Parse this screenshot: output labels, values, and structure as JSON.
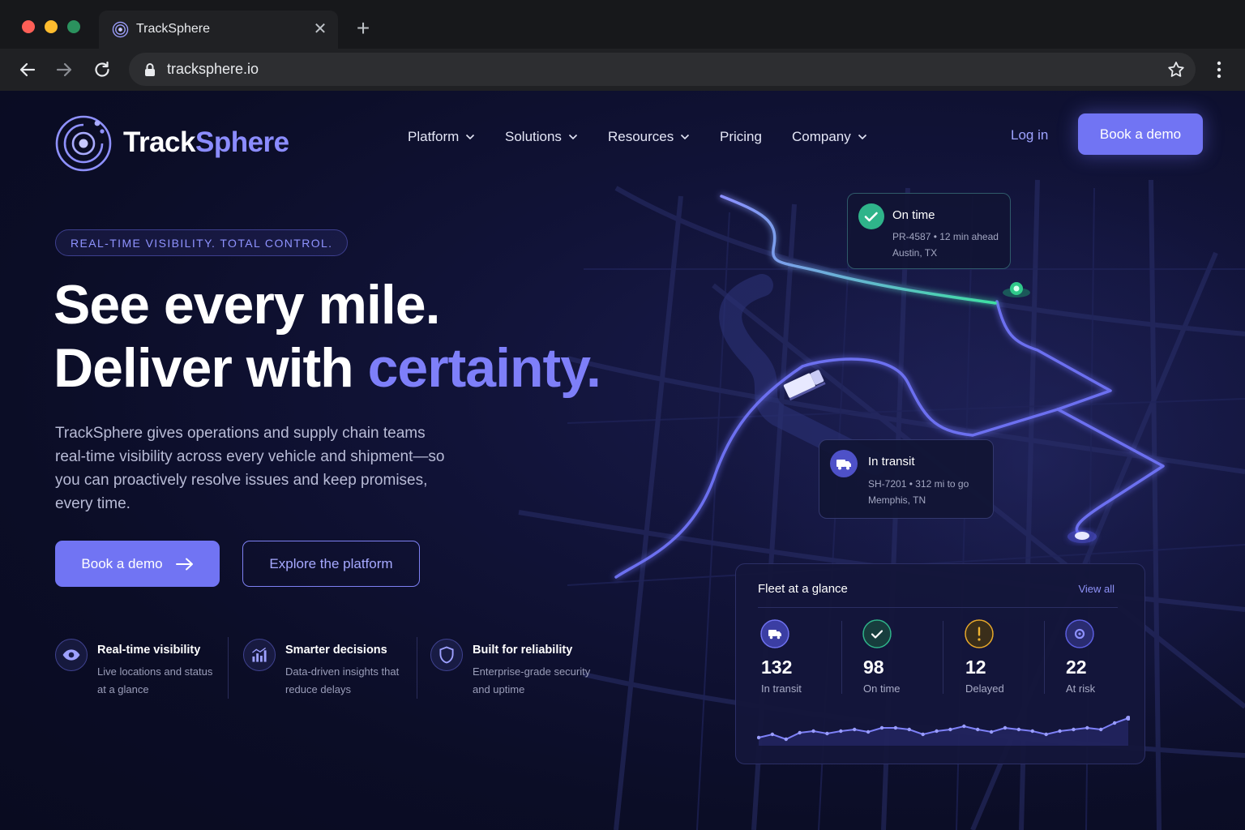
{
  "browser": {
    "tab_title": "TrackSphere",
    "url": "tracksphere.io"
  },
  "brand": {
    "name_part1": "Track",
    "name_part2": "Sphere"
  },
  "nav": {
    "items": [
      {
        "label": "Platform",
        "dropdown": true
      },
      {
        "label": "Solutions",
        "dropdown": true
      },
      {
        "label": "Resources",
        "dropdown": true
      },
      {
        "label": "Pricing",
        "dropdown": false
      },
      {
        "label": "Company",
        "dropdown": true
      }
    ],
    "login_label": "Log in",
    "cta_label": "Book a demo"
  },
  "hero": {
    "eyebrow": "REAL-TIME VISIBILITY. TOTAL CONTROL.",
    "headline_line1": "See every mile.",
    "headline_line2_prefix": "Deliver with ",
    "headline_line2_accent": "certainty.",
    "description": "TrackSphere gives operations and supply chain teams real-time visibility across every vehicle and shipment—so you can proactively resolve issues and keep promises, every time.",
    "primary_cta": "Book a demo",
    "secondary_cta": "Explore the platform"
  },
  "features": [
    {
      "icon": "eye-icon",
      "title": "Real-time visibility",
      "desc_line1": "Live locations and status",
      "desc_line2": "at a glance"
    },
    {
      "icon": "bar-chart-icon",
      "title": "Smarter decisions",
      "desc_line1": "Data-driven insights that",
      "desc_line2": "reduce delays"
    },
    {
      "icon": "shield-icon",
      "title": "Built for reliability",
      "desc_line1": "Enterprise-grade security",
      "desc_line2": "and uptime"
    }
  ],
  "map_cards": {
    "on_time": {
      "title": "On time",
      "line1": "PR-4587 • 12 min ahead",
      "line2": "Austin, TX"
    },
    "in_transit": {
      "title": "In transit",
      "line1": "SH-7201 • 312 mi to go",
      "line2": "Memphis, TN"
    }
  },
  "fleet": {
    "title": "Fleet at a glance",
    "view_all": "View all",
    "stats": [
      {
        "value": "132",
        "label": "In transit",
        "icon": "truck-icon",
        "color": "#6f72f0"
      },
      {
        "value": "98",
        "label": "On time",
        "icon": "check-icon",
        "color": "#2fb48a"
      },
      {
        "value": "12",
        "label": "Delayed",
        "icon": "alert-icon",
        "color": "#e8a92a"
      },
      {
        "value": "22",
        "label": "At risk",
        "icon": "target-icon",
        "color": "#6f72f0"
      }
    ],
    "sparkline": [
      34,
      30,
      36,
      28,
      26,
      29,
      26,
      24,
      27,
      22,
      22,
      24,
      30,
      26,
      24,
      20,
      24,
      27,
      22,
      24,
      26,
      30,
      26,
      24,
      22,
      24,
      16,
      10
    ]
  },
  "colors": {
    "accent": "#7174f3",
    "background": "#0b0d24",
    "route_glow": "#7b7ef9",
    "on_time_green": "#2fb48a",
    "delayed_amber": "#e8a92a"
  }
}
